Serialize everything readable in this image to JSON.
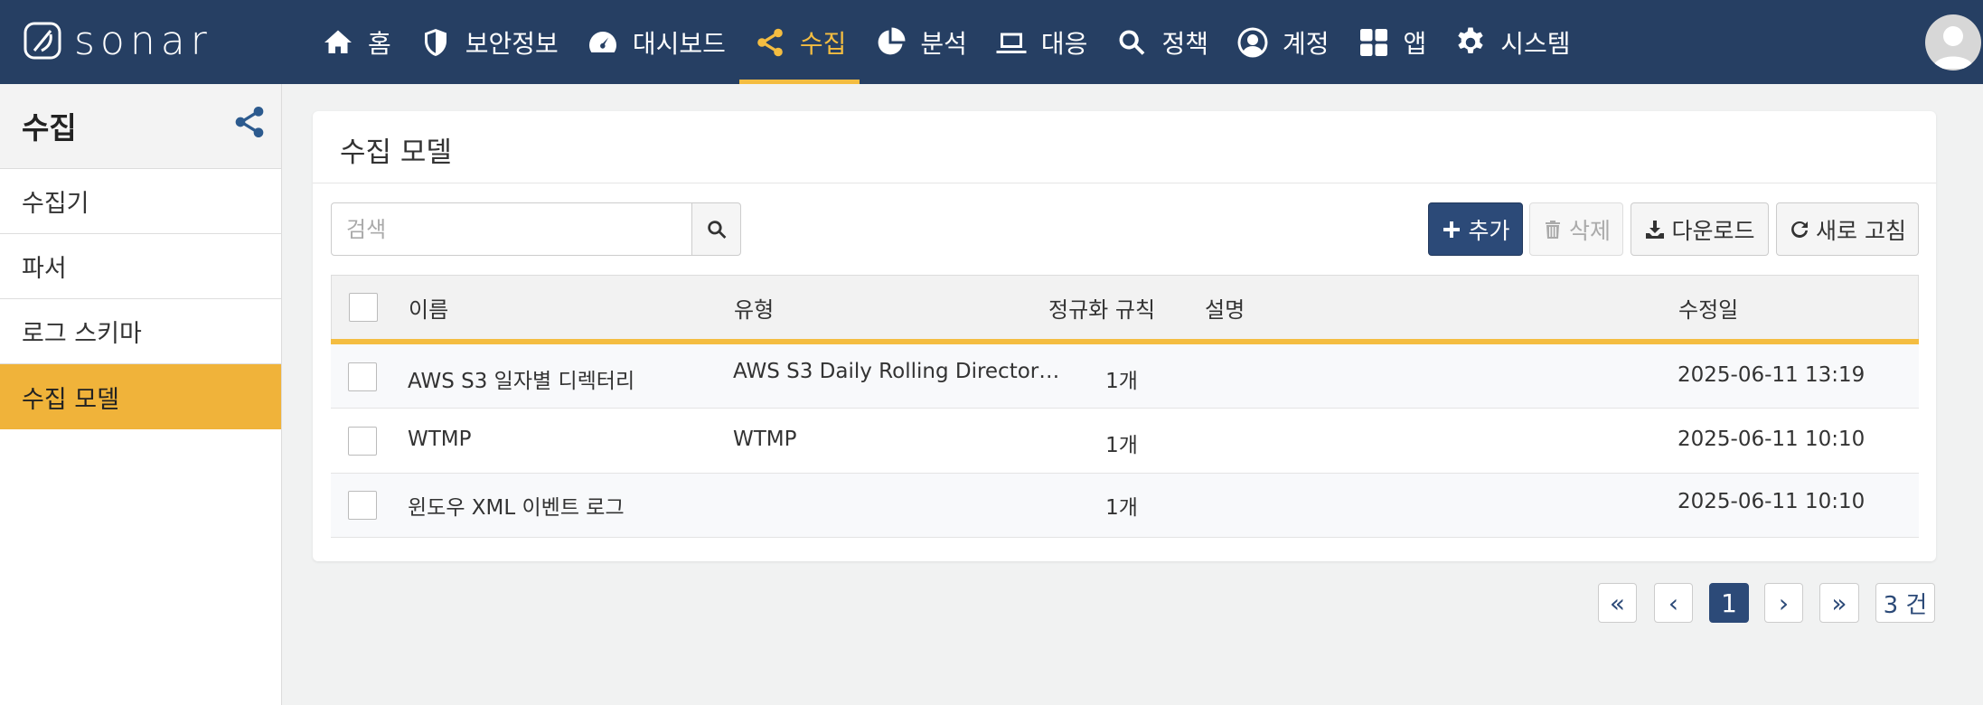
{
  "app": {
    "brand": "sonar"
  },
  "nav": [
    {
      "label": "홈",
      "icon": "home-icon"
    },
    {
      "label": "보안정보",
      "icon": "shield-icon"
    },
    {
      "label": "대시보드",
      "icon": "dashboard-icon"
    },
    {
      "label": "수집",
      "icon": "share-icon",
      "active": true
    },
    {
      "label": "분석",
      "icon": "pie-chart-icon"
    },
    {
      "label": "대응",
      "icon": "laptop-icon"
    },
    {
      "label": "정책",
      "icon": "search-icon"
    },
    {
      "label": "계정",
      "icon": "user-circle-icon"
    },
    {
      "label": "앱",
      "icon": "grid-icon"
    },
    {
      "label": "시스템",
      "icon": "gear-icon"
    }
  ],
  "sidebar": {
    "title": "수집",
    "items": [
      {
        "label": "수집기"
      },
      {
        "label": "파서"
      },
      {
        "label": "로그 스키마"
      },
      {
        "label": "수집 모델",
        "active": true
      }
    ]
  },
  "panel": {
    "title": "수집 모델",
    "search_placeholder": "검색",
    "buttons": {
      "add": "추가",
      "delete": "삭제",
      "download": "다운로드",
      "refresh": "새로 고침"
    },
    "columns": [
      "이름",
      "유형",
      "정규화 규칙",
      "설명",
      "수정일"
    ],
    "rows": [
      {
        "name": "AWS S3 일자별 디렉터리",
        "type": "AWS S3 Daily Rolling Director…",
        "rules": "1개",
        "desc": "",
        "modified": "2025-06-11 13:19"
      },
      {
        "name": "WTMP",
        "type": "WTMP",
        "rules": "1개",
        "desc": "",
        "modified": "2025-06-11 10:10"
      },
      {
        "name": "윈도우 XML 이벤트 로그",
        "type": "",
        "rules": "1개",
        "desc": "",
        "modified": "2025-06-11 10:10"
      }
    ]
  },
  "pagination": {
    "first": "«",
    "prev": "‹",
    "current": "1",
    "next": "›",
    "last": "»",
    "total": "3 건"
  },
  "colors": {
    "nav_bg": "#263f63",
    "accent": "#f4bd41",
    "primary": "#2c4a78"
  }
}
